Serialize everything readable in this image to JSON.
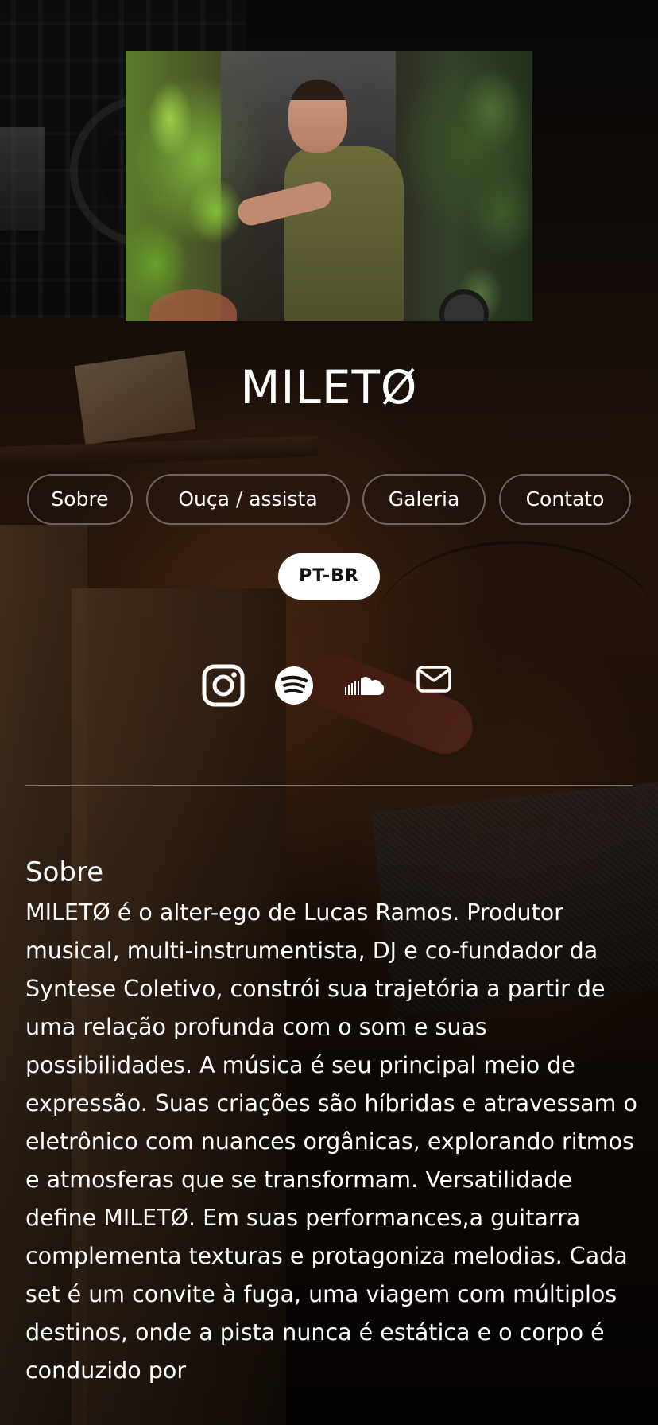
{
  "site": {
    "title": "MILETØ"
  },
  "nav": {
    "items": [
      {
        "label": "Sobre"
      },
      {
        "label": "Ouça / assista"
      },
      {
        "label": "Galeria"
      },
      {
        "label": "Contato"
      }
    ],
    "language": "PT-BR"
  },
  "social": {
    "icons": [
      "instagram-icon",
      "spotify-icon",
      "soundcloud-icon",
      "email-icon"
    ],
    "icon_color": "#ffffff"
  },
  "about": {
    "title": "Sobre",
    "text": "MILETØ é o alter-ego de Lucas Ramos. Produtor musical, multi-instrumentista, DJ e co-fundador da Syntese Coletivo, constrói sua trajetória a partir de uma relação profunda com o som e suas possibilidades. A música é seu principal meio de expressão. Suas criações são híbridas e atravessam o eletrônico com nuances orgânicas, explorando ritmos e atmosferas que se transformam. Versatilidade define MILETØ. Em suas performances,a guitarra complementa texturas e protagoniza melodias. Cada set é um convite à fuga, uma viagem com múltiplos destinos, onde a pista nunca é estática e o corpo é conduzido por"
  },
  "colors": {
    "background": "#120b07",
    "text": "#ffffff",
    "language_button_bg": "#ffffff",
    "language_button_text": "#111111"
  }
}
